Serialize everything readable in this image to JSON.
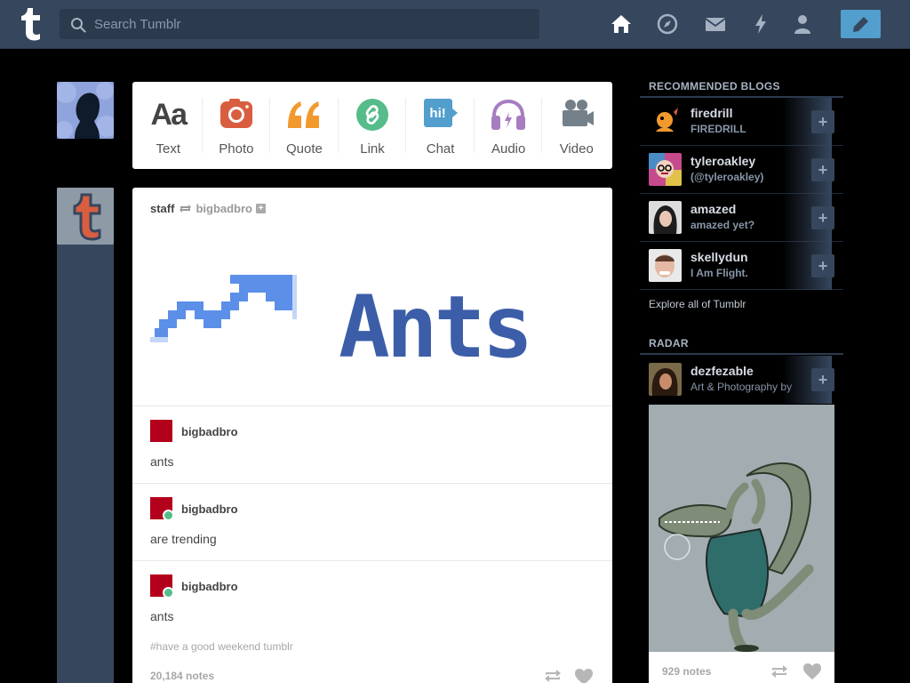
{
  "header": {
    "search_placeholder": "Search Tumblr",
    "nav": [
      "home-icon",
      "explore-icon",
      "inbox-icon",
      "activity-icon",
      "account-icon"
    ],
    "accent": "#529ecc",
    "background": "#36465d"
  },
  "post_types": [
    {
      "label": "Text",
      "glyph": "Aa",
      "color": "#444444"
    },
    {
      "label": "Photo",
      "color": "#d95e40"
    },
    {
      "label": "Quote",
      "color": "#f2992e"
    },
    {
      "label": "Link",
      "color": "#56bc8a"
    },
    {
      "label": "Chat",
      "glyph": "hi!",
      "color": "#529ecc"
    },
    {
      "label": "Audio",
      "color": "#a77dc2"
    },
    {
      "label": "Video",
      "color": "#748089"
    }
  ],
  "post": {
    "author": "staff",
    "reblogged_from": "bigbadbro",
    "image_text": "Ants",
    "reblogs": [
      {
        "name": "bigbadbro",
        "text": "ants"
      },
      {
        "name": "bigbadbro",
        "text": "are trending"
      },
      {
        "name": "bigbadbro",
        "text": "ants"
      }
    ],
    "tags": "#have a good weekend tumblr",
    "notes": "20,184 notes"
  },
  "sidebar": {
    "recommended_title": "RECOMMENDED BLOGS",
    "recommended": [
      {
        "title": "firedrill",
        "subtitle": "FIREDRILL"
      },
      {
        "title": "tyleroakley",
        "subtitle": "(@tyleroakley)"
      },
      {
        "title": "amazed",
        "subtitle": "amazed yet?"
      },
      {
        "title": "skellydun",
        "subtitle": "I Am Flight."
      }
    ],
    "follow_label": "+",
    "explore": "Explore all of Tumblr",
    "radar_title": "RADAR",
    "radar": {
      "title": "dezfezable",
      "subtitle": "Art & Photography by",
      "notes": "929 notes"
    }
  }
}
